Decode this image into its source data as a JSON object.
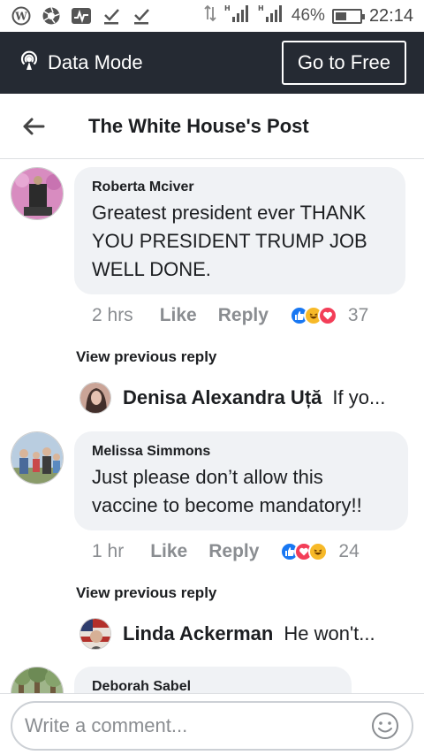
{
  "status": {
    "battery": "46%",
    "battery_level": 0.46,
    "time": "22:14",
    "net1": "H",
    "net2": "H"
  },
  "databar": {
    "label": "Data Mode",
    "button": "Go to Free"
  },
  "header": {
    "title": "The White House's Post"
  },
  "comments": [
    {
      "author": "Roberta Mciver",
      "text": "Greatest president ever THANK YOU PRESIDENT TRUMP JOB WELL DONE.",
      "time": "2 hrs",
      "like": "Like",
      "reply": "Reply",
      "reaction_count": "37",
      "reactions": [
        "like",
        "haha",
        "love"
      ],
      "view_previous": "View previous reply",
      "reply_author": "Denisa Alexandra Uță",
      "reply_text": "If yo..."
    },
    {
      "author": "Melissa Simmons",
      "text": "Just please don’t allow this vaccine to become mandatory!!",
      "time": "1 hr",
      "like": "Like",
      "reply": "Reply",
      "reaction_count": "24",
      "reactions": [
        "like",
        "love",
        "haha"
      ],
      "view_previous": "View previous reply",
      "reply_author": "Linda Ackerman",
      "reply_text": "He won't..."
    },
    {
      "author": "Deborah Sabel"
    }
  ],
  "composer": {
    "placeholder": "Write a comment..."
  },
  "colors": {
    "databar": "#252a33",
    "bubble": "#f0f2f5",
    "like": "#1877f2",
    "love": "#f33e58",
    "haha": "#f7b928"
  }
}
